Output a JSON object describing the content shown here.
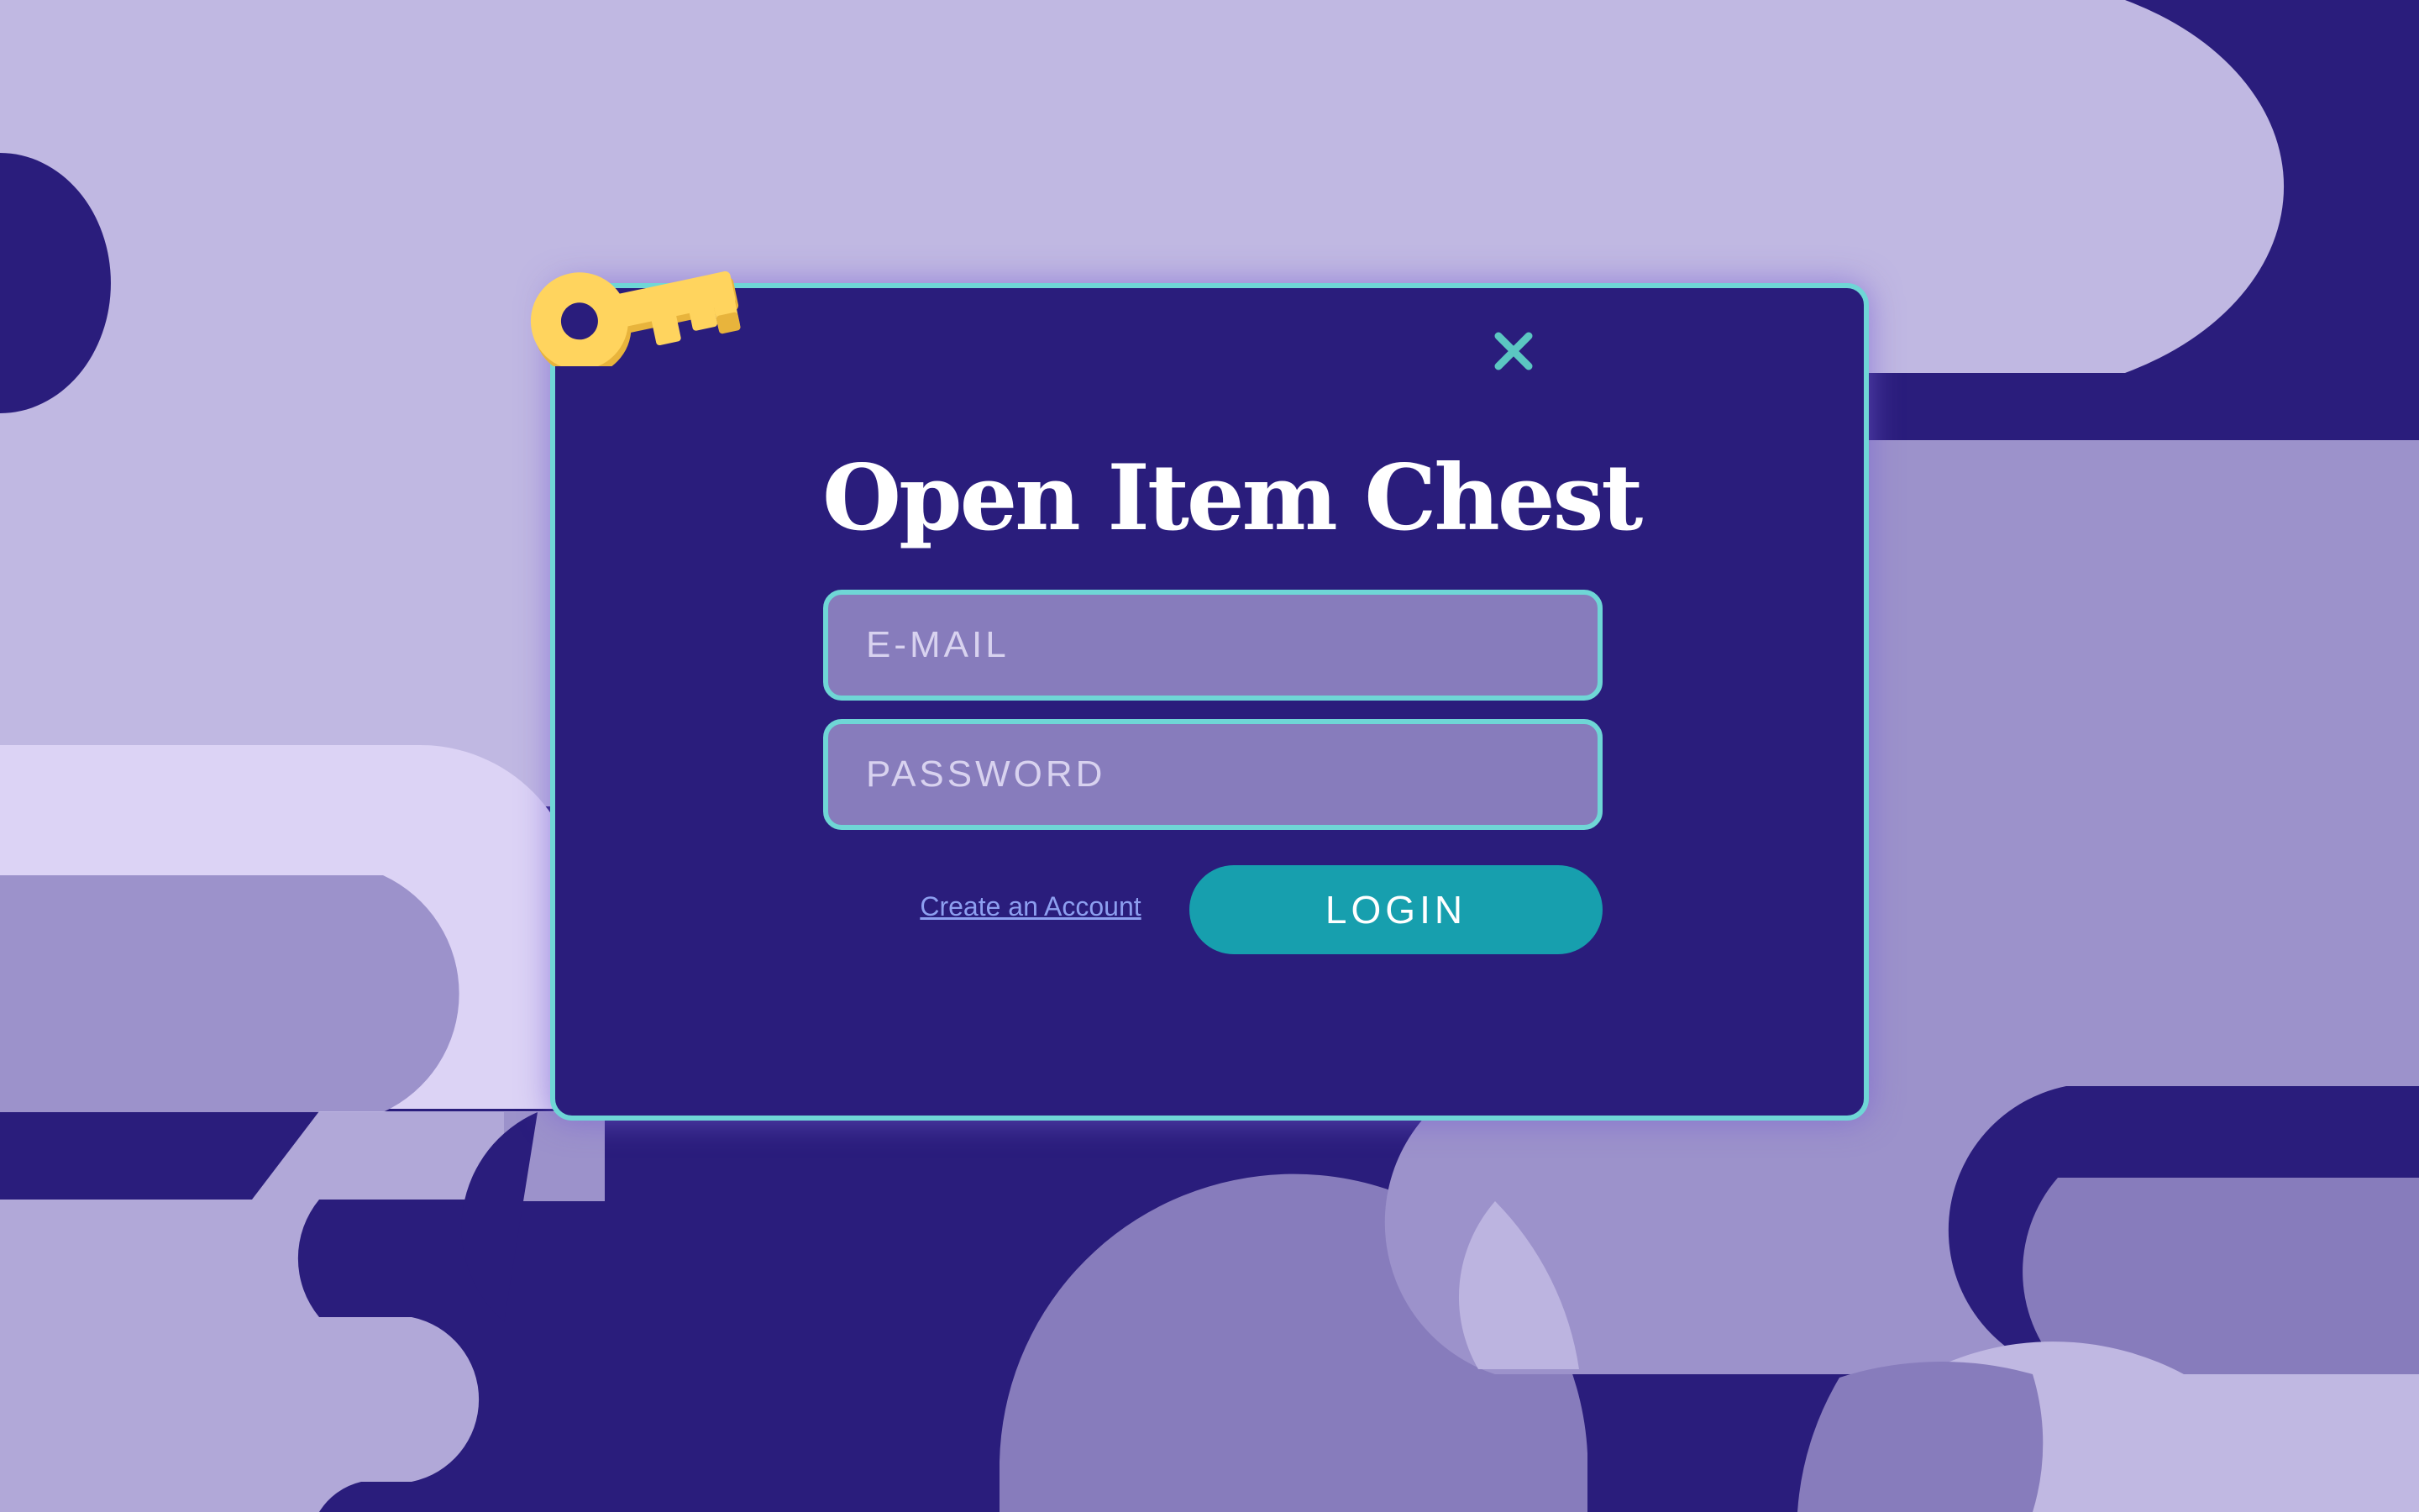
{
  "modal": {
    "title": "Open Item Chest",
    "email_placeholder": "E-MAIL",
    "password_placeholder": "PASSWORD",
    "create_account_label": "Create an Account",
    "login_label": "LOGIN",
    "close_icon": "close-icon",
    "key_icon": "key-icon"
  },
  "colors": {
    "background_dark": "#2a1d7c",
    "background_light": "#c0b8e2",
    "background_mid": "#9c92cb",
    "accent_teal": "#6fd6d6",
    "button_teal": "#179fae",
    "field_fill": "#877cbc",
    "link": "#8d9ff0",
    "key_yellow": "#ffd45e"
  }
}
